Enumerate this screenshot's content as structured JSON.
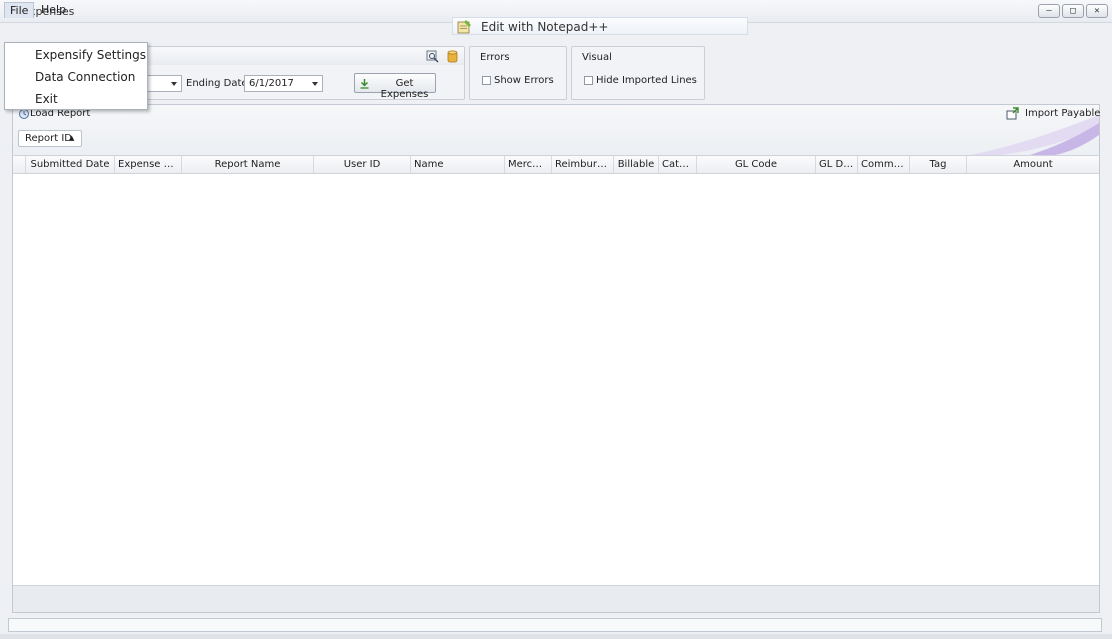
{
  "window": {
    "title": "Expenses",
    "controls": [
      "—",
      "□",
      "✕"
    ]
  },
  "menubar": {
    "file": "File",
    "help": "Help"
  },
  "file_menu": {
    "items": [
      "Expensify Settings",
      "Data Connection",
      "Exit"
    ]
  },
  "tooltip": {
    "text": "Edit with Notepad++"
  },
  "filters": {
    "ending_date_label": "Ending Date:",
    "ending_date_value": "6/1/2017",
    "get_expenses_label": "Get Expenses"
  },
  "errors_group": {
    "title": "Errors",
    "show_errors": "Show Errors",
    "show_errors_checked": false
  },
  "visual_group": {
    "title": "Visual",
    "hide_imported": "Hide Imported Lines",
    "hide_imported_checked": false
  },
  "panel": {
    "load_report": "Load Report",
    "import_payable": "Import Payable",
    "group_by": "Report ID",
    "sort_indicator": "▲"
  },
  "grid": {
    "columns": [
      "Submitted Date",
      "Expense Date",
      "Report Name",
      "User ID",
      "Name",
      "Merchant",
      "Reimbursa...",
      "Billable",
      "Cate...",
      "GL Code",
      "GL De...",
      "Comments",
      "Tag",
      "Amount"
    ],
    "rows": []
  },
  "colors": {
    "accent": "#c8b7e6",
    "brand_icon": "#c0161d"
  }
}
